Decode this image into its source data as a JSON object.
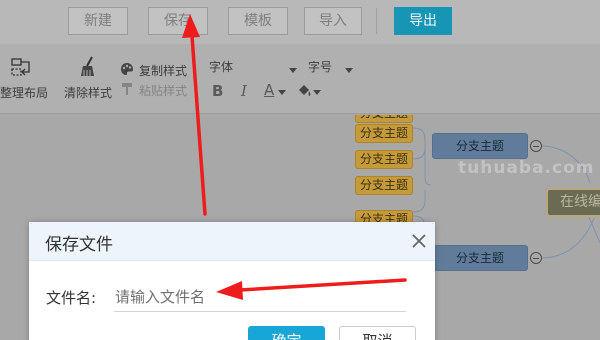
{
  "toolbar": {
    "new_label": "新建",
    "save_label": "保存",
    "template_label": "模板",
    "import_label": "导入",
    "export_label": "导出"
  },
  "format_bar": {
    "arrange_label": "整理布局",
    "clear_style_label": "清除样式",
    "copy_style_label": "复制样式",
    "paste_style_label": "粘贴样式",
    "font_label": "字体",
    "font_size_label": "字号",
    "bold": "B",
    "italic": "I",
    "font_color": "A"
  },
  "mindmap": {
    "leaf_label": "分支主题",
    "branch_label": "分支主题",
    "center_label": "在线编"
  },
  "watermark": "tuhuaba.com",
  "dialog": {
    "title": "保存文件",
    "filename_label": "文件名:",
    "filename_placeholder": "请输入文件名",
    "ok_label": "确定",
    "cancel_label": "取消"
  },
  "colors": {
    "export_button": "#1795b4",
    "leaf_node": "#c59b3a",
    "branch_node": "#607c9a",
    "ok_button": "#17a6d6",
    "annotation_arrow": "#ee1c1c"
  },
  "icons": [
    "arrange-icon",
    "broom-icon",
    "palette-icon",
    "brush-icon",
    "font-color-icon",
    "paint-bucket-icon",
    "close-icon"
  ]
}
